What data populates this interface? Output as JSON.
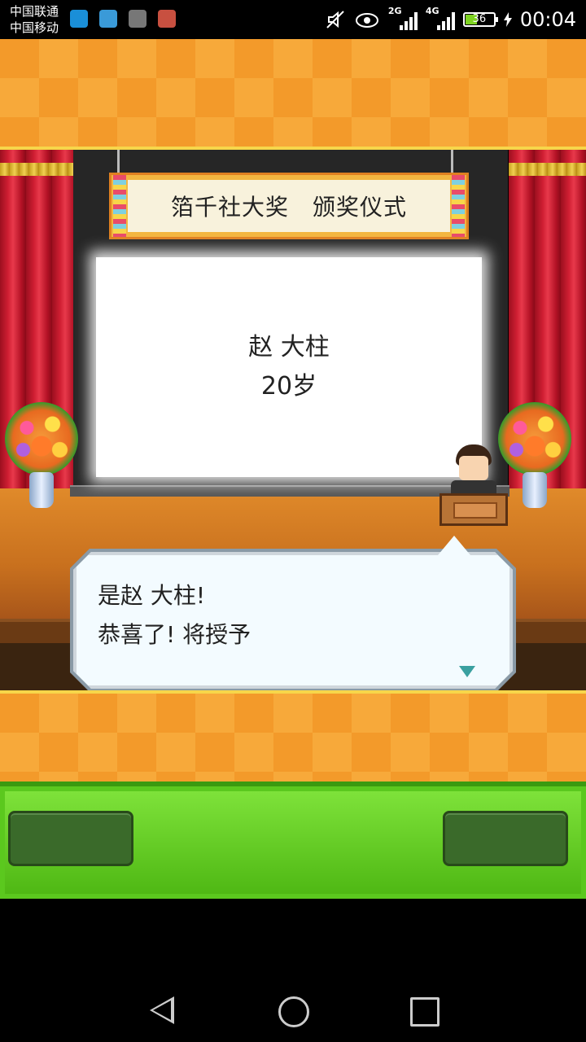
{
  "status_bar": {
    "carrier_1": "中国联通",
    "carrier_2": "中国移动",
    "app_icons": [
      "evu-app-icon",
      "health-app-icon",
      "gallery-app-icon",
      "game-app-icon"
    ],
    "signal_1_tag": "2G",
    "signal_2_tag": "4G",
    "battery_level": "36",
    "time": "00:04"
  },
  "stage": {
    "banner_title": "箔千社大奖　颁奖仪式",
    "board_name": "赵 大柱",
    "board_age": "20岁"
  },
  "dialog": {
    "line_1": "是赵 大柱!",
    "line_2": "恭喜了! 将授予"
  },
  "colors": {
    "checker_orange": "#f39a2a",
    "curtain_red": "#d01f33",
    "menu_green": "#5bc81e",
    "button_dark_green": "#3a6a2a"
  }
}
